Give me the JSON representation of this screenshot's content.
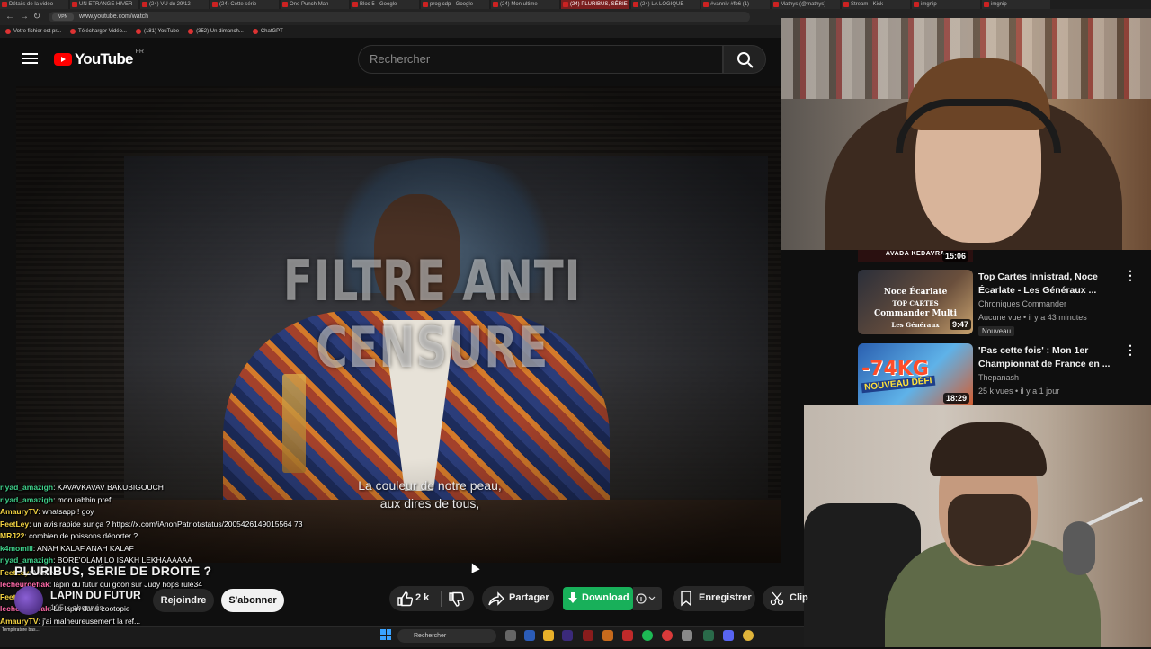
{
  "browser": {
    "tabs": [
      "Détails de la vidéo",
      "UN ETRANGE HIVER",
      "(24) VU du 29/12",
      "(24) Cette série",
      "One Punch Man",
      "Bloc 5 - Google",
      "prog cdp - Google",
      "(24) Mon ultime",
      "(24) PLURIBUS, SÉRIE",
      "(24) LA LOGIQUE",
      "#vanniv #fb6 (1)",
      "Mathys (@mathys)",
      "Stream - Kick",
      "imgnip",
      "imgnip"
    ],
    "active_tab_index": 8,
    "url": "www.youtube.com/watch",
    "url_badge": "VPN",
    "bookmarks": [
      "Votre fichier est pr...",
      "Télécharger Vidéo...",
      "(181) YouTube",
      "(352) Un dimanch...",
      "ChatGPT"
    ]
  },
  "youtube": {
    "logo_text": "YouTube",
    "country_code": "FR",
    "search_placeholder": "Rechercher",
    "accent": "#ff0000"
  },
  "video": {
    "overlay_title": [
      "FILTRE ANTI",
      "CENSURE"
    ],
    "subtitles": [
      "La couleur de notre peau,",
      "aux dires de tous,"
    ],
    "title": "PLURIBUS, SÉRIE DE DROITE ?",
    "channel": "LAPIN DU FUTUR",
    "subscribers": "105 k abonnés",
    "join_label": "Rejoindre",
    "subscribe_label": "S'abonner",
    "likes": "2 k",
    "share_label": "Partager",
    "download_label": "Download",
    "save_label": "Enregistrer",
    "clip_label": "Clip"
  },
  "recommendations": [
    {
      "top_label": "AVADA KEDAVRA",
      "duration": "15:06"
    },
    {
      "thumb_lines": [
        "Noce Écarlate",
        "TOP CARTES",
        "Commander Multi",
        "Les Généraux"
      ],
      "duration": "9:47",
      "title": "Top Cartes Innistrad, Noce Écarlate - Les Généraux ...",
      "channel": "Chroniques Commander",
      "meta": "Aucune vue • il y a 43 minutes",
      "badge": "Nouveau"
    },
    {
      "thumb_lines": [
        "-74KG",
        "NOUVEAU DÉFI"
      ],
      "duration": "18:29",
      "title": "'Pas cette fois' : Mon 1er Championnat de France en ...",
      "channel": "Thepanash",
      "meta": "25 k vues • il y a 1 jour"
    }
  ],
  "chat": [
    {
      "user": "riyad_amazigh",
      "msg": "KAVAVKAVAV BAKUBIGOUCH",
      "color": "#3fd08a"
    },
    {
      "user": "riyad_amazigh",
      "msg": "mon rabbin pref",
      "color": "#3fd08a"
    },
    {
      "user": "AmauryTV",
      "msg": "whatsapp ! goy",
      "color": "#f5d442"
    },
    {
      "user": "FeetLey",
      "msg": "un avis rapide sur ça ? https://x.com/iAnonPatriot/status/2005426149015564 73",
      "color": "#f5d442"
    },
    {
      "user": "MRJ22",
      "msg": "combien de poissons déporter ?",
      "color": "#f5d442"
    },
    {
      "user": "k4momill",
      "msg": "ANAH KALAF ANAH KALAF",
      "color": "#3fd08a"
    },
    {
      "user": "riyad_amazigh",
      "msg": "BORE'OLAM LO ISAKH LEKHAAAAAA",
      "color": "#3fd08a"
    },
    {
      "user": "FeetLey",
      "msg": "MANN",
      "color": "#f5d442"
    },
    {
      "user": "lecheurdefiak",
      "msg": "lapin du futur qui goon sur Judy hops rule34",
      "color": "#ff6aa8"
    },
    {
      "user": "FeetLey",
      "msg": "",
      "color": "#f5d442"
    },
    {
      "user": "lecheurdefiak",
      "msg": "Le lapin dans zootopie",
      "color": "#ff6aa8"
    },
    {
      "user": "AmauryTV",
      "msg": "j'ai malheureusement la ref...",
      "color": "#f5d442"
    }
  ],
  "taskbar": {
    "search_label": "Rechercher",
    "weather_label": "Température bas..."
  }
}
